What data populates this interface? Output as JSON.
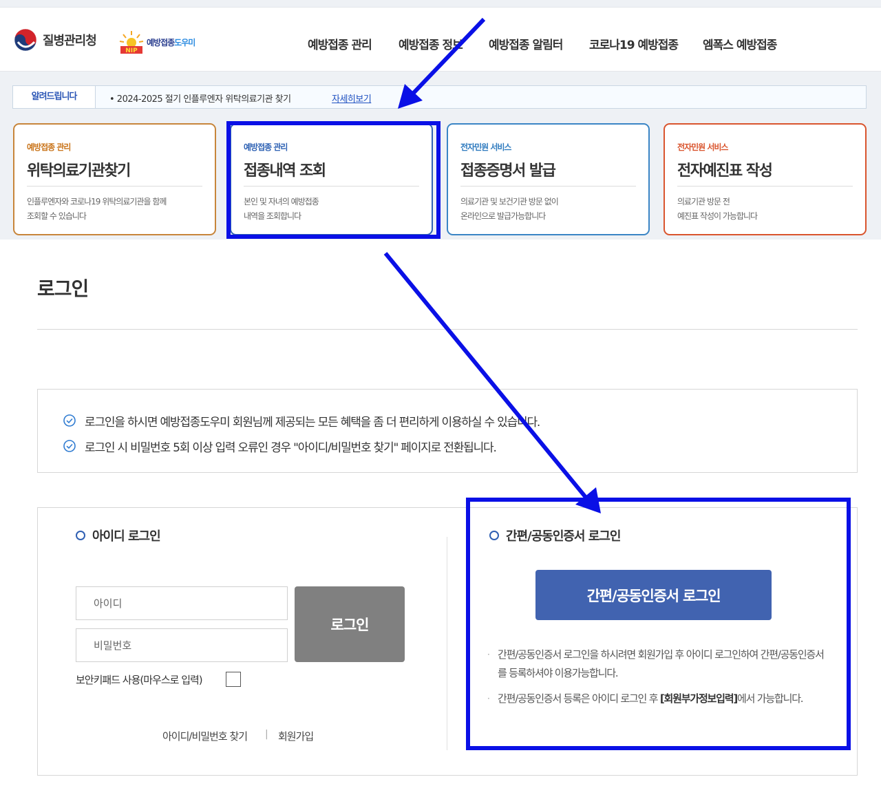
{
  "header": {
    "org_name": "질병관리청",
    "site_logo_text1": "예방접종",
    "site_logo_text2": "도우미",
    "site_logo_badge": "NIP",
    "nav": [
      "예방접종 관리",
      "예방접종 정보",
      "예방접종 알림터",
      "코로나19 예방접종",
      "엠폭스 예방접종"
    ]
  },
  "notice": {
    "badge": "알려드립니다",
    "message": "• 2024-2025 절기 인플루엔자 위탁의료기관 찾기",
    "link": "자세히보기"
  },
  "cards": [
    {
      "category": "예방접종 관리",
      "title": "위탁의료기관찾기",
      "desc1": "인플루엔자와 코로나19 위탁의료기관을 함께",
      "desc2": "조회할 수 있습니다"
    },
    {
      "category": "예방접종 관리",
      "title": "접종내역 조회",
      "desc1": "본인 및 자녀의 예방접종",
      "desc2": "내역을 조회합니다"
    },
    {
      "category": "전자민원 서비스",
      "title": "접종증명서 발급",
      "desc1": "의료기관 및 보건기관 방문 없이",
      "desc2": "온라인으로 발급가능합니다"
    },
    {
      "category": "전자민원 서비스",
      "title": "전자예진표 작성",
      "desc1": "의료기관 방문 전",
      "desc2": "예진표 작성이 가능합니다"
    }
  ],
  "login_page": {
    "title": "로그인",
    "info": [
      "로그인을 하시면 예방접종도우미 회원님께 제공되는 모든 혜택을 좀 더 편리하게 이용하실 수 있습니다.",
      "로그인 시 비밀번호 5회 이상 입력 오류인 경우 \"아이디/비밀번호 찾기\" 페이지로 전환됩니다."
    ],
    "id_login": {
      "title": "아이디 로그인",
      "id_placeholder": "아이디",
      "pw_placeholder": "비밀번호",
      "login_button": "로그인",
      "keypad_label": "보안키패드 사용(마우스로 입력)",
      "find_link": "아이디/비밀번호 찾기",
      "separator": "|",
      "join_link": "회원가입"
    },
    "cert_login": {
      "title": "간편/공동인증서 로그인",
      "button": "간편/공동인증서 로그인",
      "note1": "간편/공동인증서 로그인을 하시려면 회원가입 후 아이디 로그인하여 간편/공동인증서를 등록하셔야 이용가능합니다.",
      "note2_pre": "간편/공동인증서 등록은 아이디 로그인 후 ",
      "note2_bold": "[회원부가정보입력]",
      "note2_post": "에서 가능합니다."
    }
  },
  "colors": {
    "annotation": "#0a10e6",
    "primary_button": "#4163b0",
    "login_button": "#808080",
    "accent_blue": "#2f62b4",
    "accent_orange": "#c9741a",
    "accent_red": "#d9542d"
  }
}
